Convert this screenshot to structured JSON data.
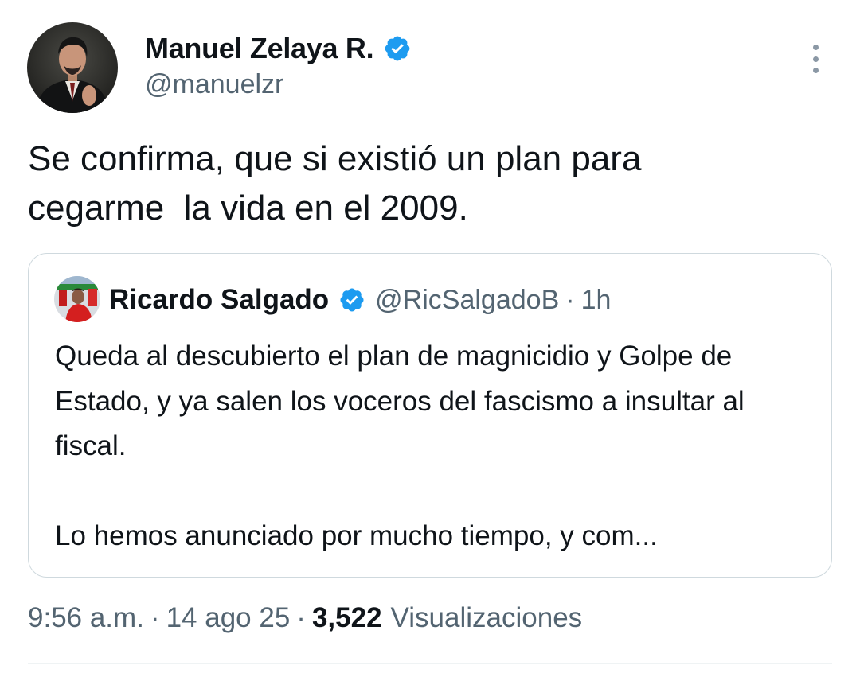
{
  "author": {
    "name": "Manuel Zelaya R.",
    "handle": "@manuelzr",
    "verified": true
  },
  "tweet": {
    "text": "Se confirma, que si existió un plan para\ncegarme  la vida en el 2009."
  },
  "quote": {
    "author_name": "Ricardo Salgado",
    "handle": "@RicSalgadoB",
    "separator": "·",
    "time": "1h",
    "verified": true,
    "paragraph1": "Queda al descubierto el plan de magnicidio y Golpe de Estado, y ya salen los voceros del fascismo a insultar al fiscal.",
    "paragraph2": "Lo hemos anunciado por mucho tiempo, y com..."
  },
  "meta": {
    "time": "9:56 a.m.",
    "separator": "·",
    "date": "14 ago 25",
    "views_count": "3,522",
    "views_label": "Visualizaciones"
  },
  "icons": {
    "verified": "verified-badge-icon",
    "more": "more-vertical-icon"
  },
  "colors": {
    "verified_blue": "#1d9bf0",
    "secondary_text": "#536471",
    "primary_text": "#0f1419",
    "border": "#cfd9de"
  }
}
